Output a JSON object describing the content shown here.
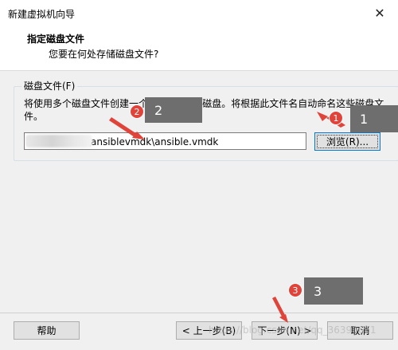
{
  "window": {
    "title": "新建虚拟机向导",
    "close_glyph": "✕"
  },
  "header": {
    "title": "指定磁盘文件",
    "subtitle": "您要在何处存储磁盘文件?"
  },
  "disk_file": {
    "group_label": "磁盘文件(F)",
    "description": "将使用多个磁盘文件创建一个 20 GB 虚拟磁盘。将根据此文件名自动命名这些磁盘文件。",
    "path_value": "k\\ansiblevmdk\\ansible.vmdk",
    "browse_label": "浏览(R)..."
  },
  "footer": {
    "help_label": "帮助",
    "prev_label": "< 上一步(B)",
    "next_label": "下一步(N) >",
    "cancel_label": "取消"
  },
  "annotations": {
    "badge1": "1",
    "callout1": "1",
    "badge2": "2",
    "callout2": "2",
    "badge3": "3",
    "callout3": "3",
    "accent_color": "#e0433a"
  },
  "watermark": "https://blog.csdn.net/qq_36390661"
}
